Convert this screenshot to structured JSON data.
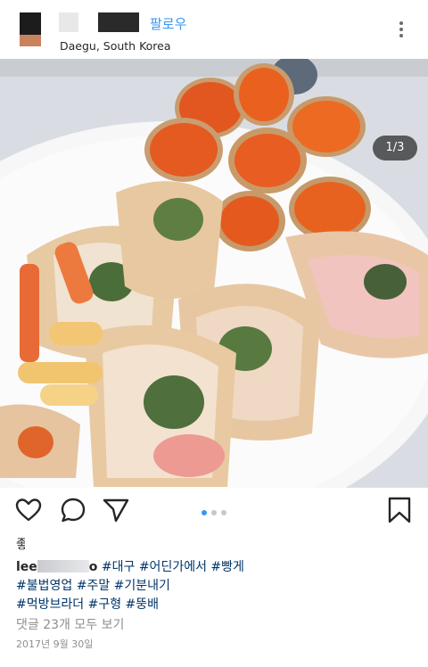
{
  "header": {
    "follow_label": "팔로우",
    "location": "Daegu, South Korea"
  },
  "photo": {
    "counter": "1/3"
  },
  "post": {
    "likes_prefix": "좋",
    "username_start": "lee",
    "username_end": "o",
    "caption_line1": [
      "#대구",
      "#어딘가에서",
      "#빵게"
    ],
    "caption_line2": [
      "#불법영업",
      "#주말",
      "#기분내기"
    ],
    "caption_line3": [
      "#먹방브라더",
      "#구형",
      "#뚱배"
    ],
    "view_comments": "댓글 23개 모두 보기",
    "date": "2017년 9월 30일"
  },
  "carousel": {
    "total": 3,
    "active": 1
  },
  "icons": {
    "like": "heart-icon",
    "comment": "comment-icon",
    "share": "paper-plane-icon",
    "save": "bookmark-icon",
    "more": "more-vertical-icon"
  }
}
